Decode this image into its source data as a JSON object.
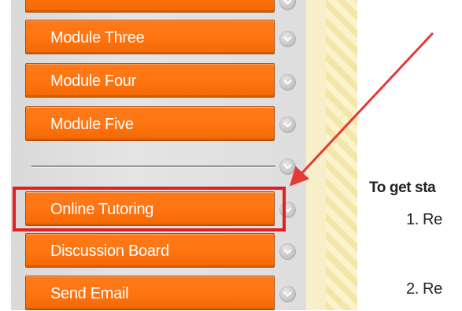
{
  "sidebar": {
    "items": [
      {
        "label": "",
        "partial": true
      },
      {
        "label": "Module Three"
      },
      {
        "label": "Module Four"
      },
      {
        "label": "Module Five"
      },
      {
        "label": "Online Tutoring",
        "highlighted": true
      },
      {
        "label": "Discussion Board"
      },
      {
        "label": "Send Email"
      }
    ],
    "expand_icon": "chevron-down-icon",
    "button_color": "#ff7410",
    "highlight_color": "#e02020"
  },
  "content": {
    "heading": "To get sta",
    "steps": [
      "1. Re",
      "2. Re"
    ]
  },
  "annotation": {
    "arrow_color": "#e53935"
  }
}
